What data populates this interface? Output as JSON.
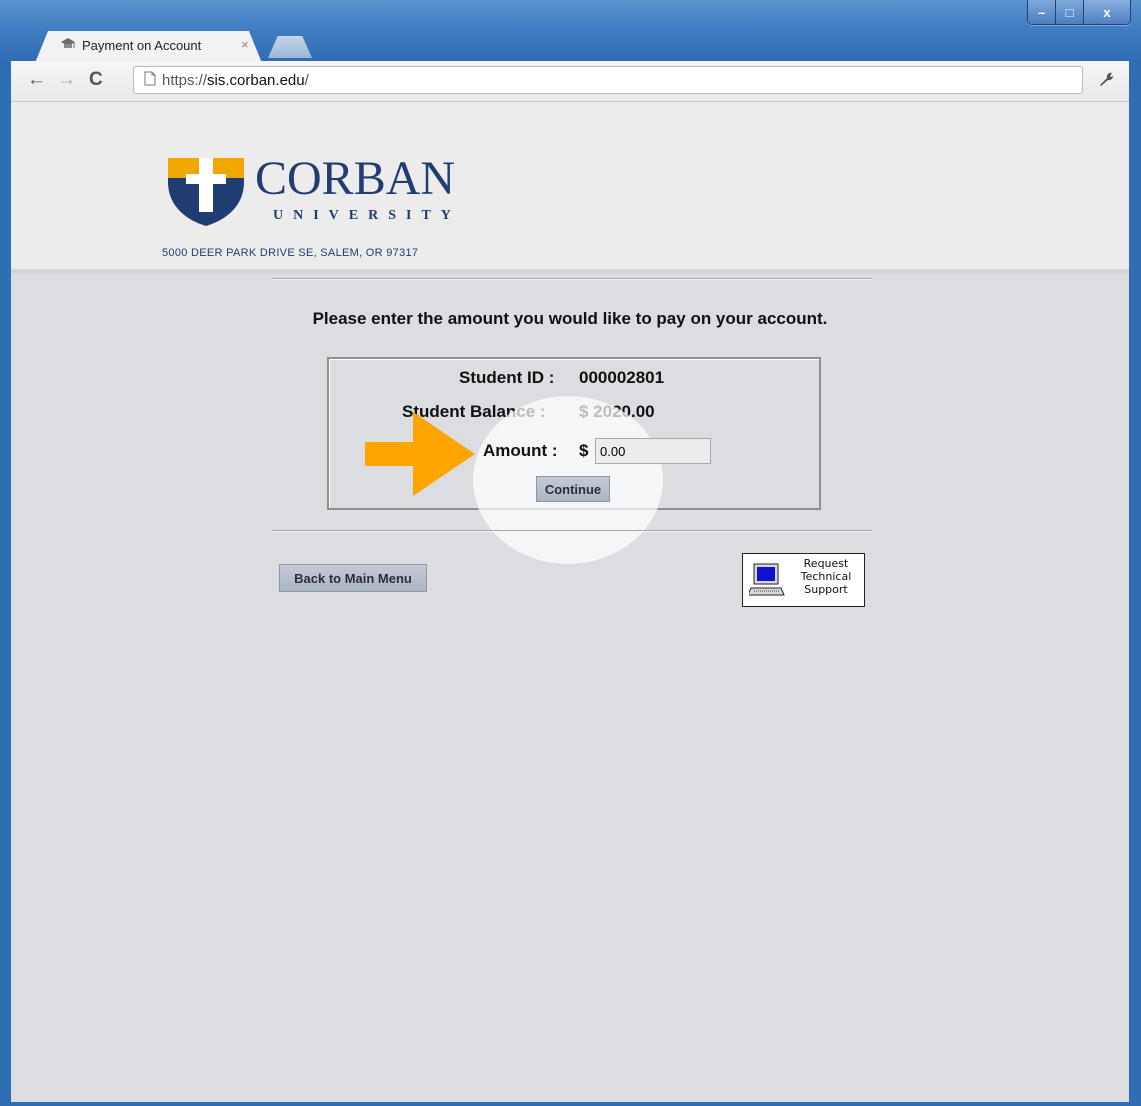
{
  "browser": {
    "tab_title": "Payment on Account",
    "tab_close": "×",
    "url_scheme": "https://",
    "url_host": "sis.corban.edu",
    "url_path": "/",
    "window_buttons": {
      "minimize": "–",
      "maximize": "□",
      "close": "x"
    }
  },
  "header": {
    "brand_name": "CORBAN",
    "brand_sub": "UNIVERSITY",
    "address": "5000 DEER PARK DRIVE SE, SALEM, OR 97317"
  },
  "main": {
    "prompt": "Please enter the amount you would like to pay on your account.",
    "student_id_label": "Student ID :",
    "student_id_value": "000002801",
    "balance_label": "Student Balance :",
    "balance_value": "$ 2020.00",
    "amount_label": "Amount :",
    "currency_symbol": "$",
    "amount_value": "0.00",
    "continue_label": "Continue",
    "back_label": "Back to Main Menu",
    "support_lines": [
      "Request",
      "Technical",
      "Support"
    ]
  },
  "colors": {
    "brand_navy": "#1f3d70",
    "brand_gold": "#f0a800",
    "arrow_orange": "#ffa500",
    "page_bg": "#dcdde1"
  }
}
